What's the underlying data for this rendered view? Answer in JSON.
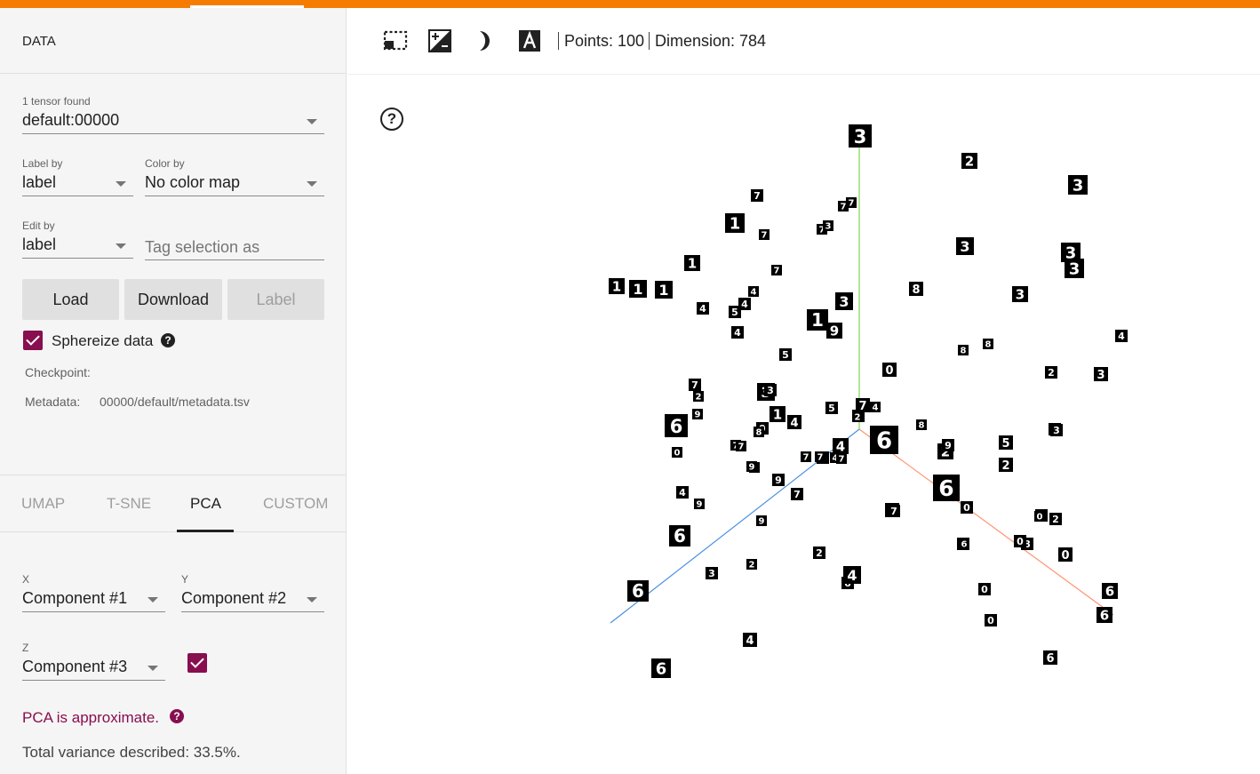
{
  "app": {
    "accent_color": "#f57c00",
    "checkbox_color": "#880e4f"
  },
  "sidebar": {
    "section_title": "DATA",
    "tensor_count_label": "1 tensor found",
    "tensor_value": "default:00000",
    "label_by": {
      "label": "Label by",
      "value": "label"
    },
    "color_by": {
      "label": "Color by",
      "value": "No color map"
    },
    "edit_by": {
      "label": "Edit by",
      "value": "label"
    },
    "tag_input": {
      "placeholder": "Tag selection as",
      "value": ""
    },
    "buttons": {
      "load": "Load",
      "download": "Download",
      "label": "Label"
    },
    "sphereize": {
      "label": "Sphereize data",
      "checked": true
    },
    "checkpoint_label": "Checkpoint:",
    "metadata_label": "Metadata:",
    "metadata_value": "00000/default/metadata.tsv",
    "tabs": [
      "UMAP",
      "T-SNE",
      "PCA",
      "CUSTOM"
    ],
    "active_tab": "PCA",
    "pca": {
      "x_label": "X",
      "x_value": "Component #1",
      "y_label": "Y",
      "y_value": "Component #2",
      "z_label": "Z",
      "z_value": "Component #3",
      "z_checked": true,
      "approx_text": "PCA is approximate.",
      "variance_text": "Total variance described: 33.5%."
    }
  },
  "toolbar": {
    "icons": [
      "select-rectangle-icon",
      "night-mode-icon",
      "contrast-icon",
      "label-icon"
    ],
    "points_text": "Points: 100",
    "dimension_text": "Dimension: 784"
  },
  "projection": {
    "axis_colors": {
      "x": "#ff7043",
      "y": "#7bd850",
      "z": "#4a90e2"
    },
    "points": [
      {
        "d": "3"
      },
      {
        "d": "2"
      },
      {
        "d": "3"
      },
      {
        "d": "7"
      },
      {
        "d": "7"
      },
      {
        "d": "7"
      },
      {
        "d": "1"
      },
      {
        "d": "7"
      },
      {
        "d": "7"
      },
      {
        "d": "3"
      },
      {
        "d": "3"
      },
      {
        "d": "3"
      },
      {
        "d": "1"
      },
      {
        "d": "7"
      },
      {
        "d": "8"
      },
      {
        "d": "3"
      },
      {
        "d": "1"
      },
      {
        "d": "1"
      },
      {
        "d": "1"
      },
      {
        "d": "4"
      },
      {
        "d": "5"
      },
      {
        "d": "4"
      },
      {
        "d": "4"
      },
      {
        "d": "3"
      },
      {
        "d": "1"
      },
      {
        "d": "9"
      },
      {
        "d": "4"
      },
      {
        "d": "3"
      },
      {
        "d": "5"
      },
      {
        "d": "4"
      },
      {
        "d": "8"
      },
      {
        "d": "8"
      },
      {
        "d": "0"
      },
      {
        "d": "2"
      },
      {
        "d": "3"
      },
      {
        "d": "7"
      },
      {
        "d": "2"
      },
      {
        "d": "9"
      },
      {
        "d": "3"
      },
      {
        "d": "3"
      },
      {
        "d": "7"
      },
      {
        "d": "4"
      },
      {
        "d": "1"
      },
      {
        "d": "4"
      },
      {
        "d": "5"
      },
      {
        "d": "4"
      },
      {
        "d": "2"
      },
      {
        "d": "6"
      },
      {
        "d": "8"
      },
      {
        "d": "3"
      },
      {
        "d": "6"
      },
      {
        "d": "2"
      },
      {
        "d": "9"
      },
      {
        "d": "5"
      },
      {
        "d": "7"
      },
      {
        "d": "9"
      },
      {
        "d": "8"
      },
      {
        "d": "0"
      },
      {
        "d": "7"
      },
      {
        "d": "4"
      },
      {
        "d": "4"
      },
      {
        "d": "7"
      },
      {
        "d": "3"
      },
      {
        "d": "7"
      },
      {
        "d": "4"
      },
      {
        "d": "9"
      },
      {
        "d": "7"
      },
      {
        "d": "2"
      },
      {
        "d": "9"
      },
      {
        "d": "6"
      },
      {
        "d": "6"
      },
      {
        "d": "0"
      },
      {
        "d": "7"
      },
      {
        "d": "0"
      },
      {
        "d": "9"
      },
      {
        "d": "4"
      },
      {
        "d": "9"
      },
      {
        "d": "2"
      },
      {
        "d": "4"
      },
      {
        "d": "0"
      },
      {
        "d": "8"
      },
      {
        "d": "0"
      },
      {
        "d": "6"
      },
      {
        "d": "0"
      },
      {
        "d": "0"
      },
      {
        "d": "0"
      },
      {
        "d": "6"
      },
      {
        "d": "6"
      },
      {
        "d": "6"
      },
      {
        "d": "3"
      },
      {
        "d": "0"
      },
      {
        "d": "6"
      },
      {
        "d": "6"
      },
      {
        "d": "2"
      },
      {
        "d": "6"
      },
      {
        "d": "4"
      },
      {
        "d": "4"
      },
      {
        "d": "3"
      },
      {
        "d": "2"
      },
      {
        "d": "7"
      }
    ]
  }
}
